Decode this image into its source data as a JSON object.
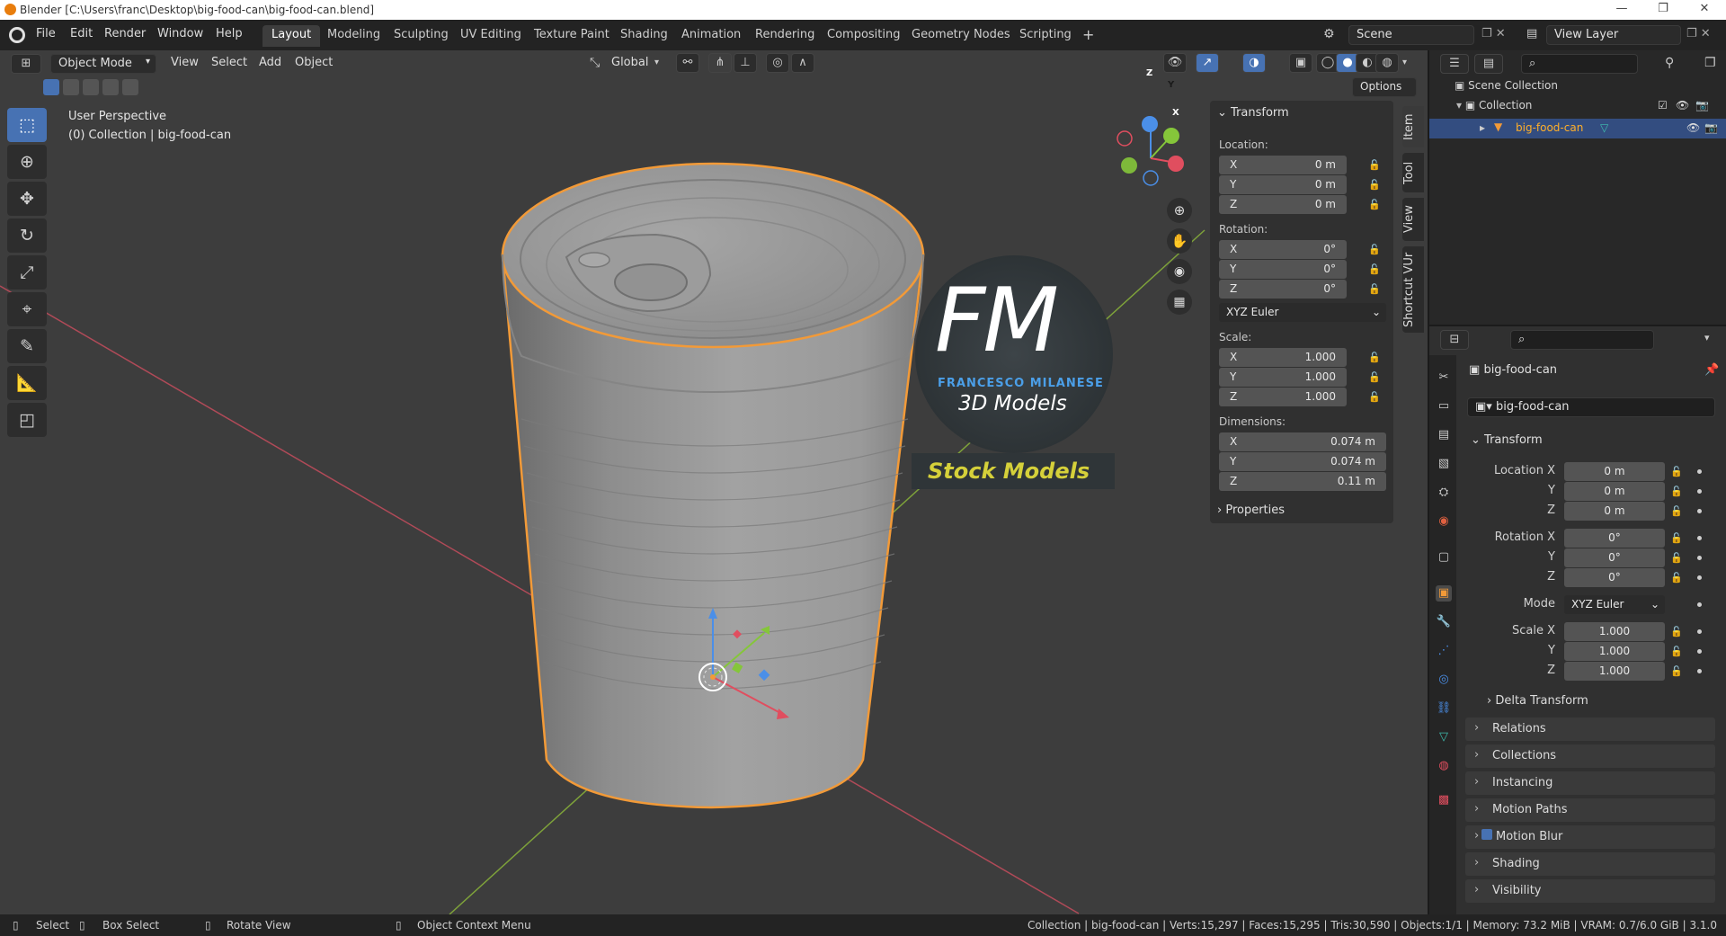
{
  "window": {
    "title": "Blender [C:\\Users\\franc\\Desktop\\big-food-can\\big-food-can.blend]",
    "controls": [
      "—",
      "❐",
      "✕"
    ]
  },
  "menu": {
    "items": [
      "File",
      "Edit",
      "Render",
      "Window",
      "Help"
    ],
    "workspaces": [
      "Layout",
      "Modeling",
      "Sculpting",
      "UV Editing",
      "Texture Paint",
      "Shading",
      "Animation",
      "Rendering",
      "Compositing",
      "Geometry Nodes",
      "Scripting"
    ],
    "active_workspace": "Layout",
    "add_workspace": "+",
    "scene": "Scene",
    "view_layer": "View Layer"
  },
  "viewport_header": {
    "mode": "Object Mode",
    "menus": [
      "View",
      "Select",
      "Add",
      "Object"
    ],
    "orientation": "Global",
    "options": "Options"
  },
  "viewport": {
    "perspective": "User Perspective",
    "collection_info": "(0) Collection | big-food-can",
    "watermark": {
      "logo": "FM",
      "name": "FRANCESCO MILANESE",
      "sub": "3D Models",
      "banner": "Stock Models"
    },
    "gizmo_axes": [
      "Z",
      "Y",
      "X"
    ]
  },
  "npanel": {
    "tabs": [
      "Item",
      "Tool",
      "View",
      "Shortcut VUr"
    ],
    "section": "Transform",
    "location_label": "Location:",
    "location": [
      {
        "axis": "X",
        "value": "0 m"
      },
      {
        "axis": "Y",
        "value": "0 m"
      },
      {
        "axis": "Z",
        "value": "0 m"
      }
    ],
    "rotation_label": "Rotation:",
    "rotation": [
      {
        "axis": "X",
        "value": "0°"
      },
      {
        "axis": "Y",
        "value": "0°"
      },
      {
        "axis": "Z",
        "value": "0°"
      }
    ],
    "rotation_mode": "XYZ Euler",
    "scale_label": "Scale:",
    "scale": [
      {
        "axis": "X",
        "value": "1.000"
      },
      {
        "axis": "Y",
        "value": "1.000"
      },
      {
        "axis": "Z",
        "value": "1.000"
      }
    ],
    "dimensions_label": "Dimensions:",
    "dimensions": [
      {
        "axis": "X",
        "value": "0.074 m"
      },
      {
        "axis": "Y",
        "value": "0.074 m"
      },
      {
        "axis": "Z",
        "value": "0.11 m"
      }
    ],
    "properties": "Properties"
  },
  "outliner": {
    "root": "Scene Collection",
    "collection": "Collection",
    "object": "big-food-can"
  },
  "properties": {
    "object_name": "big-food-can",
    "datablock": "big-food-can",
    "transform_section": "Transform",
    "location": [
      {
        "label": "Location X",
        "value": "0 m"
      },
      {
        "label": "Y",
        "value": "0 m"
      },
      {
        "label": "Z",
        "value": "0 m"
      }
    ],
    "rotation": [
      {
        "label": "Rotation X",
        "value": "0°"
      },
      {
        "label": "Y",
        "value": "0°"
      },
      {
        "label": "Z",
        "value": "0°"
      }
    ],
    "mode_label": "Mode",
    "mode": "XYZ Euler",
    "scale": [
      {
        "label": "Scale X",
        "value": "1.000"
      },
      {
        "label": "Y",
        "value": "1.000"
      },
      {
        "label": "Z",
        "value": "1.000"
      }
    ],
    "delta": "Delta Transform",
    "sections": [
      "Relations",
      "Collections",
      "Instancing",
      "Motion Paths",
      "Motion Blur",
      "Shading",
      "Visibility"
    ]
  },
  "statusbar": {
    "select": "Select",
    "box_select": "Box Select",
    "rotate": "Rotate View",
    "context": "Object Context Menu",
    "stats": "Collection | big-food-can | Verts:15,297 | Faces:15,295 | Tris:30,590 | Objects:1/1 | Memory: 73.2 MiB | VRAM: 0.7/6.0 GiB | 3.1.0"
  },
  "colors": {
    "accent": "#4772b3",
    "selection_outline": "#f29a38",
    "active_object": "#ffaf29",
    "axis_x": "#e04e5f",
    "axis_y": "#85c63a",
    "axis_z": "#4b8fe8",
    "banner_text": "#d5d03a"
  }
}
